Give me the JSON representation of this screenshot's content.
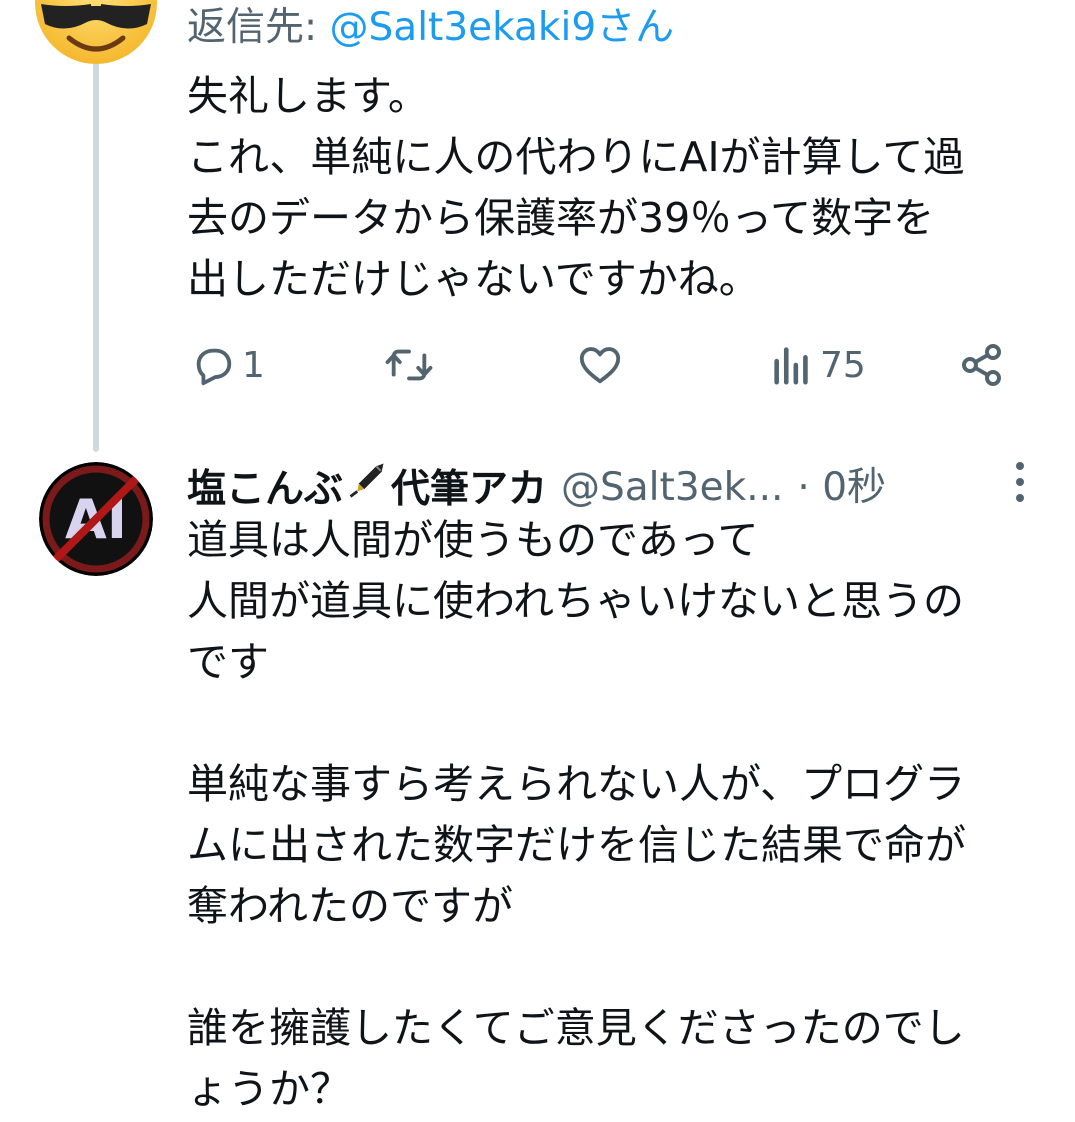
{
  "reply_tweet": {
    "replying_to_prefix": "返信先: ",
    "replying_to_handle": "@Salt3ekaki9さん",
    "text_lines": [
      "失礼します。",
      "これ、単純に人の代わりにAIが計算して過",
      "去のデータから保護率が39％って数字を",
      "出しただけじゃないですかね。"
    ],
    "actions": {
      "reply_count": "1",
      "retweet_count": "",
      "like_count": "",
      "views_count": "75"
    },
    "avatar": {
      "icon": "sunglasses-emoji-avatar"
    }
  },
  "main_tweet": {
    "display_name_before": "塩こんぶ",
    "display_name_after": "代筆アカ",
    "name_emoji_icon": "fountain-pen-icon",
    "handle": "@Salt3ek...",
    "timestamp": "· 0秒",
    "avatar": {
      "icon": "no-ai-avatar",
      "letters": "AI"
    },
    "text_lines": [
      "道具は人間が使うものであって",
      "人間が道具に使われちゃいけないと思うの",
      "です",
      "",
      "単純な事すら考えられない人が、プログラ",
      "ムに出された数字だけを信じた結果で命が",
      "奪われたのですが",
      "",
      "誰を擁護したくてご意見くださったのでし",
      "ょうか？"
    ]
  },
  "colors": {
    "text": "#0f1419",
    "secondary": "#536471",
    "link": "#1d9bf0",
    "thread_line": "#cfd9de"
  }
}
